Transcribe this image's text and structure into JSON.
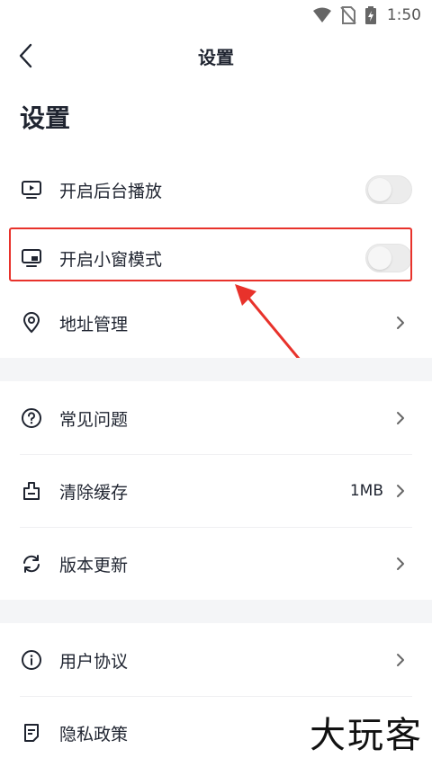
{
  "status_bar": {
    "time": "1:50"
  },
  "nav": {
    "title": "设置"
  },
  "page": {
    "heading": "设置"
  },
  "settings": {
    "background_play": {
      "label": "开启后台播放",
      "enabled": false,
      "icon": "tv-play-icon"
    },
    "pip_mode": {
      "label": "开启小窗模式",
      "enabled": false,
      "icon": "pip-window-icon"
    },
    "address": {
      "label": "地址管理",
      "icon": "location-pin-icon"
    },
    "faq": {
      "label": "常见问题",
      "icon": "question-circle-icon"
    },
    "clear_cache": {
      "label": "清除缓存",
      "value": "1MB",
      "icon": "broom-icon"
    },
    "update": {
      "label": "版本更新",
      "icon": "refresh-icon"
    },
    "user_agreement": {
      "label": "用户协议",
      "icon": "info-circle-icon"
    },
    "privacy": {
      "label": "隐私政策",
      "icon": "document-icon"
    }
  },
  "annotation": {
    "highlight_color": "#e8322b"
  },
  "watermark": {
    "text": "大玩客"
  }
}
